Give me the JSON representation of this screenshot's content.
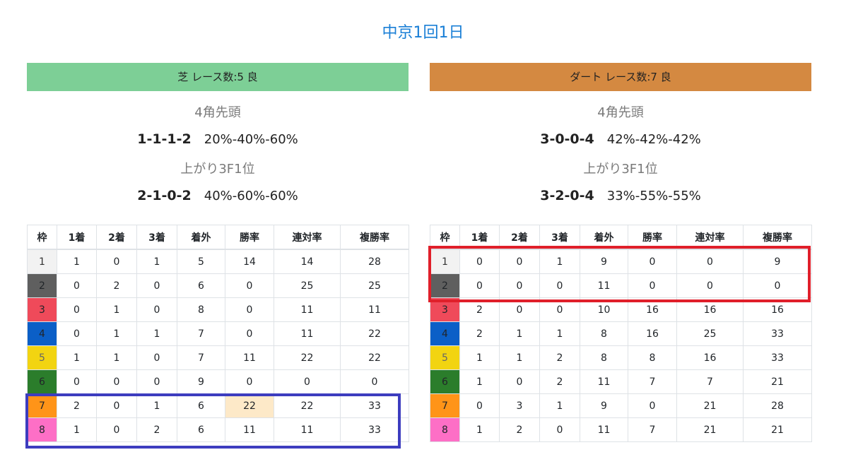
{
  "page_title": "中京1回1日",
  "colors": {
    "title": "#1a7fd6",
    "turf_header": "#7dcf96",
    "dirt_header": "#d48941",
    "highlight_cell": "#fde9c8",
    "box_blue": "#3d3dbf",
    "box_red": "#e01f2a"
  },
  "column_headers": [
    "枠",
    "1着",
    "2着",
    "3着",
    "着外",
    "勝率",
    "連対率",
    "複勝率"
  ],
  "panels": [
    {
      "header": "芝 レース数:5  良",
      "corner4_heading": "4角先頭",
      "corner4_nums": "1-1-1-2",
      "corner4_rates": "20%-40%-60%",
      "last3f_heading": "上がり3F1位",
      "last3f_nums": "2-1-0-2",
      "last3f_rates": "40%-60%-60%",
      "rows": [
        [
          "1",
          "1",
          "0",
          "1",
          "5",
          "14",
          "14",
          "28"
        ],
        [
          "2",
          "0",
          "2",
          "0",
          "6",
          "0",
          "25",
          "25"
        ],
        [
          "3",
          "0",
          "1",
          "0",
          "8",
          "0",
          "11",
          "11"
        ],
        [
          "4",
          "0",
          "1",
          "1",
          "7",
          "0",
          "11",
          "22"
        ],
        [
          "5",
          "1",
          "1",
          "0",
          "7",
          "11",
          "22",
          "22"
        ],
        [
          "6",
          "0",
          "0",
          "0",
          "9",
          "0",
          "0",
          "0"
        ],
        [
          "7",
          "2",
          "0",
          "1",
          "6",
          "22",
          "22",
          "33"
        ],
        [
          "8",
          "1",
          "0",
          "2",
          "6",
          "11",
          "11",
          "33"
        ]
      ]
    },
    {
      "header": "ダート レース数:7  良",
      "corner4_heading": "4角先頭",
      "corner4_nums": "3-0-0-4",
      "corner4_rates": "42%-42%-42%",
      "last3f_heading": "上がり3F1位",
      "last3f_nums": "3-2-0-4",
      "last3f_rates": "33%-55%-55%",
      "rows": [
        [
          "1",
          "0",
          "0",
          "1",
          "9",
          "0",
          "0",
          "9"
        ],
        [
          "2",
          "0",
          "0",
          "0",
          "11",
          "0",
          "0",
          "0"
        ],
        [
          "3",
          "2",
          "0",
          "0",
          "10",
          "16",
          "16",
          "16"
        ],
        [
          "4",
          "2",
          "1",
          "1",
          "8",
          "16",
          "25",
          "33"
        ],
        [
          "5",
          "1",
          "1",
          "2",
          "8",
          "8",
          "16",
          "33"
        ],
        [
          "6",
          "1",
          "0",
          "2",
          "11",
          "7",
          "7",
          "21"
        ],
        [
          "7",
          "0",
          "3",
          "1",
          "9",
          "0",
          "21",
          "28"
        ],
        [
          "8",
          "1",
          "2",
          "0",
          "11",
          "7",
          "21",
          "21"
        ]
      ]
    }
  ]
}
